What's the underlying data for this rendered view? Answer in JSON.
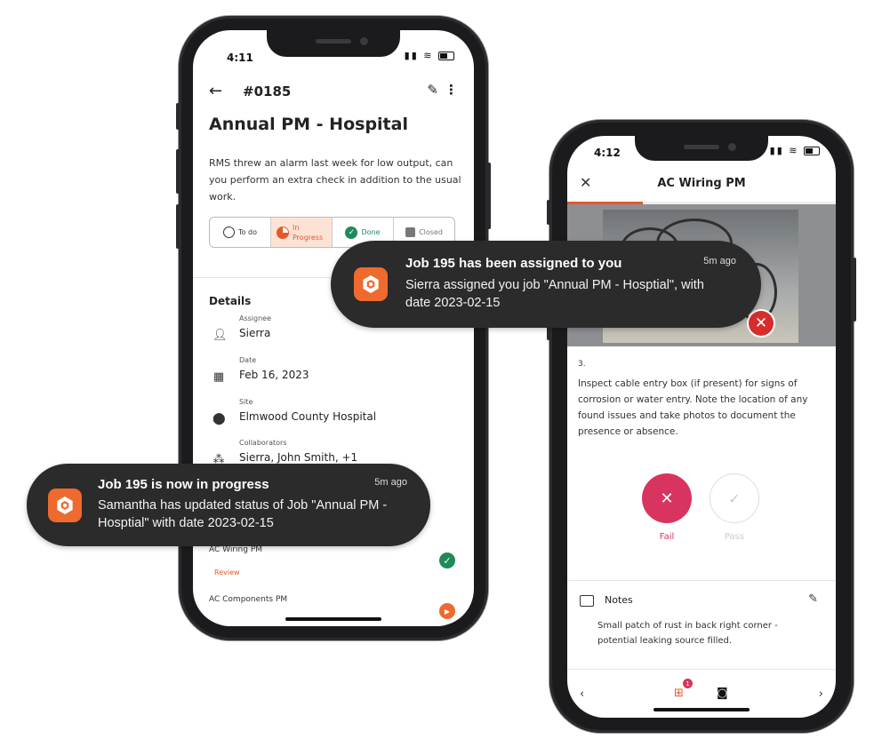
{
  "phone1": {
    "time": "4:11",
    "job_number": "#0185",
    "title": "Annual PM - Hospital",
    "description": "RMS threw an alarm last week for low output, can you perform an extra check in addition to the usual work.",
    "status_options": [
      {
        "label": "To do",
        "state": "inactive"
      },
      {
        "label": "In Progress",
        "state": "active"
      },
      {
        "label": "Done",
        "state": "inactive"
      },
      {
        "label": "Closed",
        "state": "inactive"
      }
    ],
    "details_heading": "Details",
    "details": [
      {
        "label": "Assignee",
        "value": "Sierra",
        "icon": "person-icon"
      },
      {
        "label": "Date",
        "value": "Feb 16, 2023",
        "icon": "calendar-icon"
      },
      {
        "label": "Site",
        "value": "Elmwood County Hospital",
        "icon": "location-pin-icon"
      },
      {
        "label": "Collaborators",
        "value": "Sierra, John Smith, +1",
        "icon": "group-icon"
      }
    ],
    "checklists": [
      {
        "name": "AC Wiring PM",
        "status": "Review"
      },
      {
        "name": "AC Components PM",
        "status": ""
      }
    ]
  },
  "phone2": {
    "time": "4:12",
    "title": "AC Wiring PM",
    "step_number": "3.",
    "instruction": "Inspect cable entry box (if present) for signs of corrosion or water entry. Note the location of any found issues and take photos to document the presence or absence.",
    "fail_label": "Fail",
    "pass_label": "Pass",
    "notes_label": "Notes",
    "notes_text": "Small patch of rust in back right corner - potential leaking source filled.",
    "checklist_badge": "1"
  },
  "notifications": [
    {
      "title": "Job 195 has been assigned to you",
      "time": "5m ago",
      "body": "Sierra assigned you job \"Annual PM - Hosptial\", with date 2023-02-15"
    },
    {
      "title": "Job 195  is now in progress",
      "time": "5m ago",
      "body": "Samantha has updated status of Job \"Annual PM - Hosptial\" with date 2023-02-15"
    }
  ],
  "colors": {
    "accent": "#e5582c",
    "done_green": "#1e8a5b",
    "fail_pink": "#d8345f",
    "toast_bg": "#2b2b2b"
  }
}
